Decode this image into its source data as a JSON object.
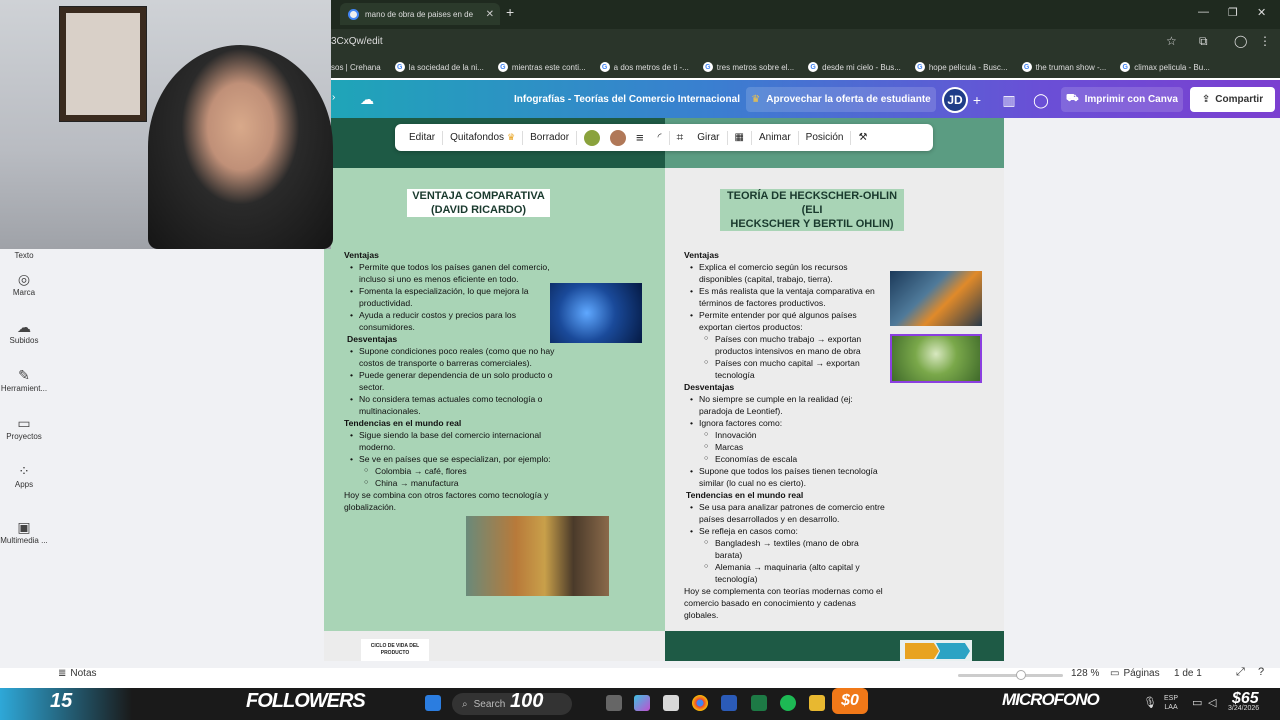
{
  "browser": {
    "tab_title": "mano de obra de paises en de",
    "url_fragment": "3CxQw/edit",
    "bookmarks": [
      "sos | Crehana",
      "la sociedad de la ni...",
      "mientras este conti...",
      "a dos metros de ti -...",
      "tres metros sobre el...",
      "desde mi cielo - Bus...",
      "hope pelicula - Busc...",
      "the truman show -...",
      "climax pelicula - Bu..."
    ]
  },
  "canva": {
    "doc_title": "Infografías - Teorías del Comercio Internacional",
    "promo": "Aprovechar la oferta de estudiante",
    "avatar": "JD",
    "print": "Imprimir con Canva",
    "share": "Compartir"
  },
  "toolbar": {
    "editar": "Editar",
    "quitafondos": "Quitafondos",
    "borrador": "Borrador",
    "girar": "Girar",
    "animar": "Animar",
    "posicion": "Posición",
    "color1": "#8aa23c",
    "color2": "#b07858"
  },
  "sidebar": {
    "items": [
      "Texto",
      "Marca",
      "Subidos",
      "Herramient...",
      "Proyectos",
      "Apps",
      "Multimedia ..."
    ]
  },
  "left_slide": {
    "title_line1": "VENTAJA COMPARATIVA",
    "title_line2": "(DAVID RICARDO)",
    "ventajas_head": "Ventajas",
    "ventajas": [
      "Permite que todos los países ganen del comercio, incluso si uno es menos eficiente en todo.",
      "Fomenta la especialización, lo que mejora la productividad.",
      "Ayuda a reducir costos y precios para los consumidores."
    ],
    "desventajas_head": "Desventajas",
    "desventajas": [
      "Supone condiciones poco reales (como que no hay costos de transporte o barreras comerciales).",
      "Puede generar dependencia de un solo producto o sector.",
      "No considera temas actuales como tecnología o multinacionales."
    ],
    "tendencias_head": "Tendencias en el mundo real",
    "tendencias": [
      "Sigue siendo la base del comercio internacional moderno.",
      "Se ve en países que se especializan, por ejemplo:"
    ],
    "ejemplos": [
      "Colombia → café, flores",
      "China → manufactura"
    ],
    "cierre": "Hoy se combina con otros factores como tecnología y globalización."
  },
  "right_slide": {
    "title_line1": "TEORÍA DE HECKSCHER-OHLIN (ELI",
    "title_line2": "HECKSCHER Y BERTIL OHLIN)",
    "ventajas_head": "Ventajas",
    "ventajas": [
      "Explica el comercio según los recursos disponibles (capital, trabajo, tierra).",
      "Es más realista que la ventaja comparativa en términos de factores productivos.",
      "Permite entender por qué algunos países exportan ciertos productos:"
    ],
    "ventajas_sub": [
      "Países con mucho trabajo → exportan productos intensivos en mano de obra",
      "Países con mucho capital → exportan tecnología"
    ],
    "desventajas_head": "Desventajas",
    "desventajas_a": [
      "No siempre se cumple en la realidad (ej: paradoja de Leontief).",
      "Ignora factores como:"
    ],
    "desventajas_sub": [
      "Innovación",
      "Marcas",
      "Economías de escala"
    ],
    "desventajas_b": [
      "Supone que todos los países tienen tecnología similar (lo cual no es cierto)."
    ],
    "tendencias_head": "Tendencias en el mundo real",
    "tendencias": [
      "Se usa para analizar patrones de comercio entre países desarrollados y en desarrollo.",
      "Se refleja en casos como:"
    ],
    "tendencias_sub": [
      "Bangladesh → textiles (mano de obra barata)",
      "Alemania → maquinaria (alto capital y tecnología)"
    ],
    "cierre": "Hoy se complementa con teorías modernas como el comercio basado en conocimiento y cadenas globales."
  },
  "next_slide": {
    "cycle_label": "CICLO DE VIDA DEL PRODUCTO"
  },
  "footer": {
    "notas": "Notas",
    "zoom": "128 %",
    "pages": "Páginas",
    "page_count": "1 de 1",
    "zoom_fraction": 0.6
  },
  "taskbar": {
    "followers_count": "15",
    "followers_label": "FOLLOWERS",
    "search": "Search",
    "count100": "100",
    "dollar0": "$0",
    "micro": "MICROFONO",
    "lang1": "ESP",
    "lang2": "LAA",
    "dollar65": "$65",
    "date": "3/24/2026"
  }
}
